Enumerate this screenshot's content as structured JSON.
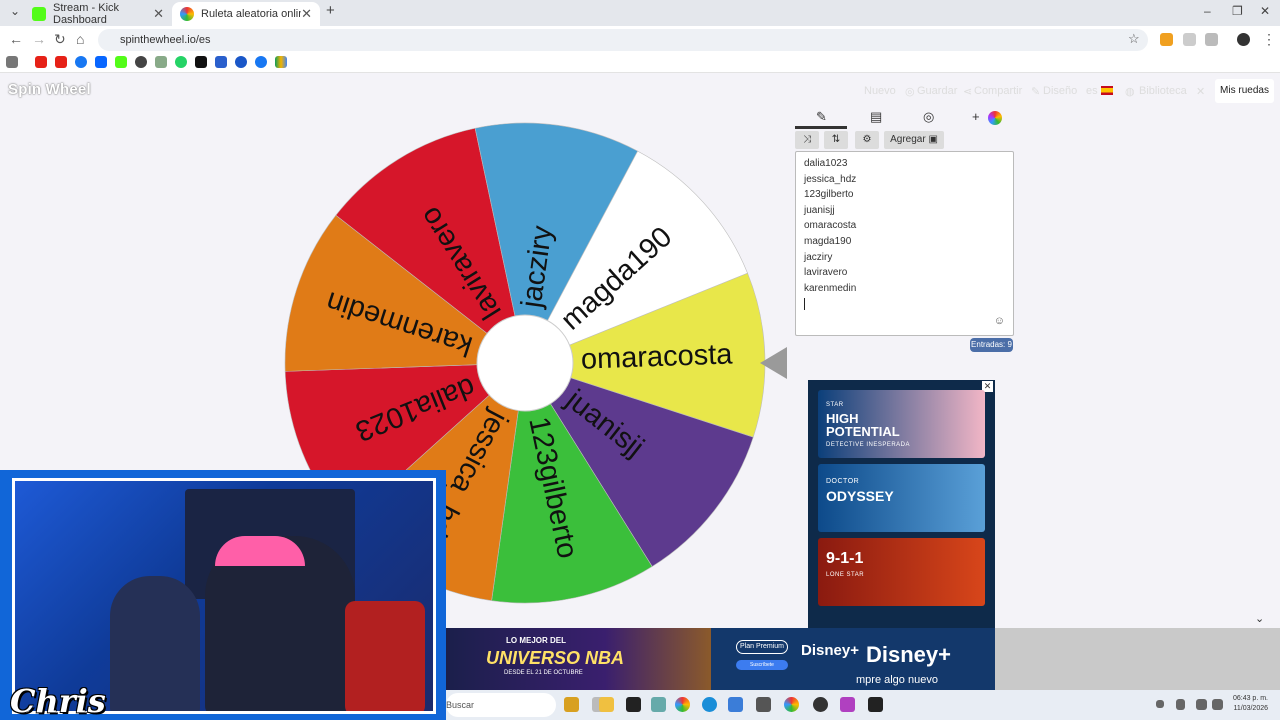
{
  "browser": {
    "tabs": [
      {
        "title": "Stream - Kick Dashboard"
      },
      {
        "title": "Ruleta aleatoria online – ruleta"
      }
    ],
    "new_tab": "+",
    "window_controls": [
      "–",
      "❐",
      "✕"
    ],
    "url": "spinthewheel.io/es"
  },
  "site": {
    "logo": "Spin Wheel",
    "menu": {
      "nuevo": "Nuevo",
      "guardar": "Guardar",
      "compartir": "Compartir",
      "diseno": "Diseño",
      "idioma": "es",
      "biblioteca": "Biblioteca",
      "mis_ruedas": "Mis ruedas"
    }
  },
  "wheel": {
    "segments": [
      {
        "label": "omaracosta",
        "color": "#e8e74a"
      },
      {
        "label": "juanisjj",
        "color": "#5d3a8e"
      },
      {
        "label": "123gilberto",
        "color": "#3bbf3b"
      },
      {
        "label": "jessica_hdz",
        "color": "#e07b17"
      },
      {
        "label": "dalia1023",
        "color": "#d6162a"
      },
      {
        "label": "karenmedin",
        "color": "#e07b17"
      },
      {
        "label": "laviravero",
        "color": "#d6162a"
      },
      {
        "label": "jacziry",
        "color": "#4a9fd1"
      },
      {
        "label": "magda190",
        "color": "#ffffff"
      }
    ]
  },
  "editor": {
    "tools": {
      "agregar": "Agregar"
    },
    "entries": [
      "dalia1023",
      "jessica_hdz",
      "123gilberto",
      "juanisjj",
      "omaracosta",
      "magda190",
      "jacziry",
      "laviravero",
      "karenmedin"
    ],
    "count_label": "Entradas: 9"
  },
  "ads": {
    "card1": {
      "title": "HIGH POTENTIAL",
      "sub": "DETECTIVE INESPERADA",
      "top": "STAR"
    },
    "card2": {
      "title": "ODYSSEY",
      "top": "DOCTOR"
    },
    "card3": {
      "title": "9-1-1",
      "sub": "LONE STAR"
    },
    "banner_nba": {
      "line1": "LO MEJOR DEL",
      "line2": "UNIVERSO NBA",
      "line3": "DESDE EL 21 DE OCTUBRE"
    },
    "banner_disney": {
      "plan": "Plan Premium",
      "sub": "Suscríbete",
      "logo": "Disney+",
      "tagline": "mpre algo nuevo"
    }
  },
  "webcam": {
    "name": "Chris"
  },
  "taskbar": {
    "search": "Buscar",
    "time": "06:43 p. m.",
    "date": "11/03/2026"
  }
}
